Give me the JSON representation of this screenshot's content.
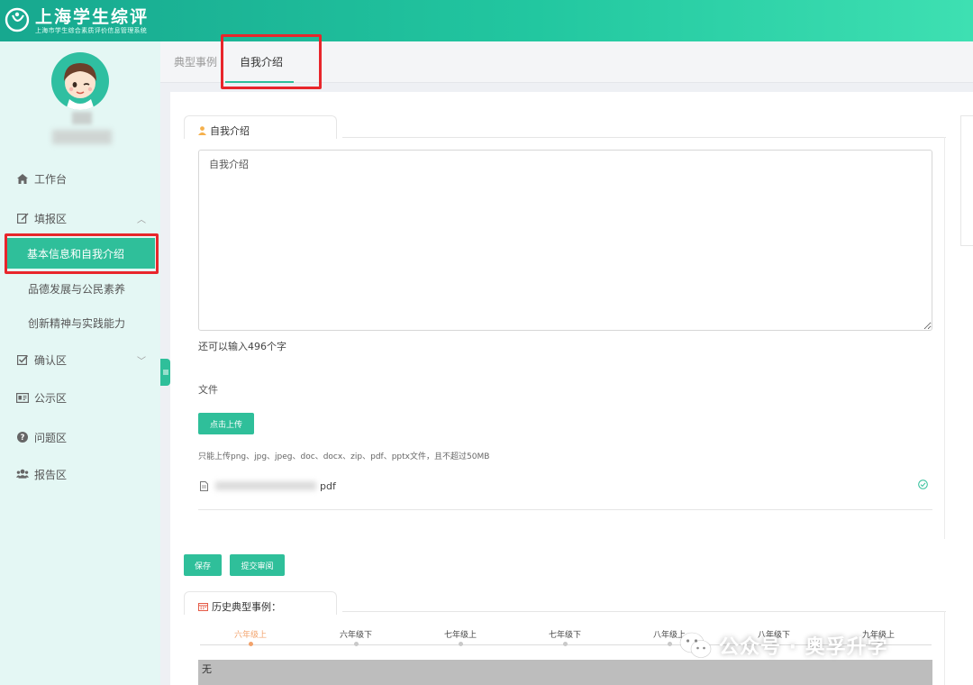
{
  "header": {
    "title": "上海学生综评",
    "subtitle": "上海市学生综合素质评价信息管理系统"
  },
  "sidebar": {
    "workbench": "工作台",
    "fill_area": "填报区",
    "sub_items": [
      "基本信息和自我介绍",
      "品德发展与公民素养",
      "创新精神与实践能力"
    ],
    "confirm_area": "确认区",
    "publicity_area": "公示区",
    "issues_area": "问题区",
    "report_area": "报告区"
  },
  "tabs": [
    "典型事例",
    "自我介绍"
  ],
  "self_intro": {
    "section_title": "自我介绍",
    "textarea_value": "自我介绍",
    "counter": "还可以输入496个字",
    "file_label": "文件",
    "upload_button": "点击上传",
    "upload_hint": "只能上传png、jpg、jpeg、doc、docx、zip、pdf、pptx文件，且不超过50MB",
    "file_ext": "pdf"
  },
  "actions": {
    "save": "保存",
    "submit": "提交审阅"
  },
  "history": {
    "title": "历史典型事例：",
    "grades": [
      "六年级上",
      "六年级下",
      "七年级上",
      "七年级下",
      "八年级上",
      "八年级下",
      "九年级上"
    ],
    "active_index": 0,
    "empty_text": "无"
  },
  "watermark": {
    "text": "公众号 · 奥孚升学"
  },
  "colors": {
    "accent": "#2fbf9a",
    "highlight": "#e8262b",
    "timeline_active": "#f2a26b"
  }
}
